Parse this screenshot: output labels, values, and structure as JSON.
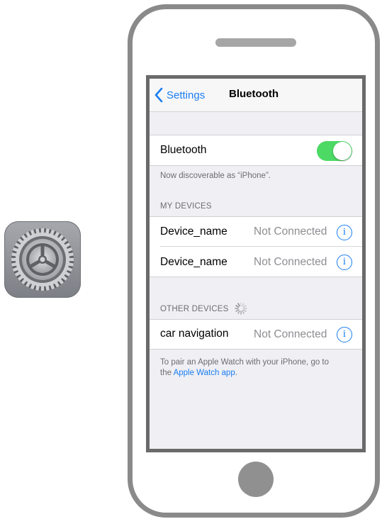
{
  "nav": {
    "back_label": "Settings",
    "title": "Bluetooth"
  },
  "bluetooth": {
    "label": "Bluetooth",
    "enabled": true,
    "discoverable_text": "Now discoverable as “iPhone”."
  },
  "my_devices": {
    "header": "MY DEVICES",
    "items": [
      {
        "name": "Device_name",
        "status": "Not Connected"
      },
      {
        "name": "Device_name",
        "status": "Not Connected"
      }
    ]
  },
  "other_devices": {
    "header": "OTHER DEVICES",
    "items": [
      {
        "name": "car navigation",
        "status": "Not Connected"
      }
    ]
  },
  "footer": {
    "text_line1": "To pair an Apple Watch with your iPhone, go to",
    "text_prefix": "the ",
    "link_text": "Apple Watch app",
    "text_suffix": "."
  },
  "icons": {
    "app": "settings-gear-icon",
    "back": "chevron-left-icon",
    "info": "info-icon",
    "spinner": "activity-spinner-icon"
  },
  "colors": {
    "accent": "#1a7ef2",
    "toggle_on": "#4cd964",
    "secondary_text": "#8e8e93"
  }
}
